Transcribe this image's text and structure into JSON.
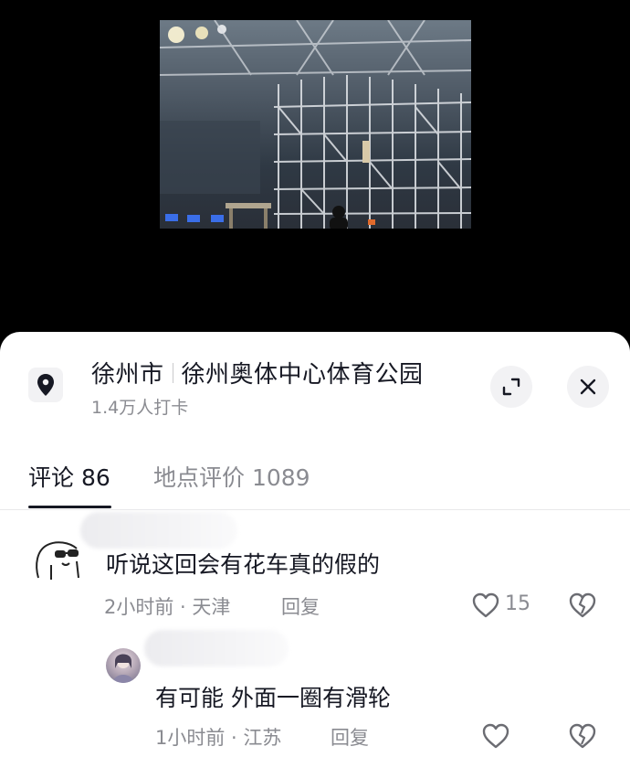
{
  "location": {
    "city": "徐州市",
    "place": "徐州奥体中心体育公园",
    "checkins": "1.4万人打卡"
  },
  "tabs": [
    {
      "label": "评论 86",
      "active": true
    },
    {
      "label": "地点评价 1089",
      "active": false
    }
  ],
  "comments": [
    {
      "text": "听说这回会有花车真的假的",
      "time": "2小时前",
      "region": "天津",
      "reply_label": "回复",
      "likes": "15"
    },
    {
      "text": "有可能 外面一圈有滑轮",
      "time": "1小时前",
      "region": "江苏",
      "reply_label": "回复"
    }
  ],
  "colors": {
    "text_primary": "#161823",
    "text_secondary": "#8a8b91",
    "sheet_bg": "#ffffff",
    "button_bg": "#f2f2f4"
  },
  "icons": [
    "location-pin-icon",
    "expand-icon",
    "close-icon",
    "heart-icon",
    "dislike-heart-icon"
  ]
}
